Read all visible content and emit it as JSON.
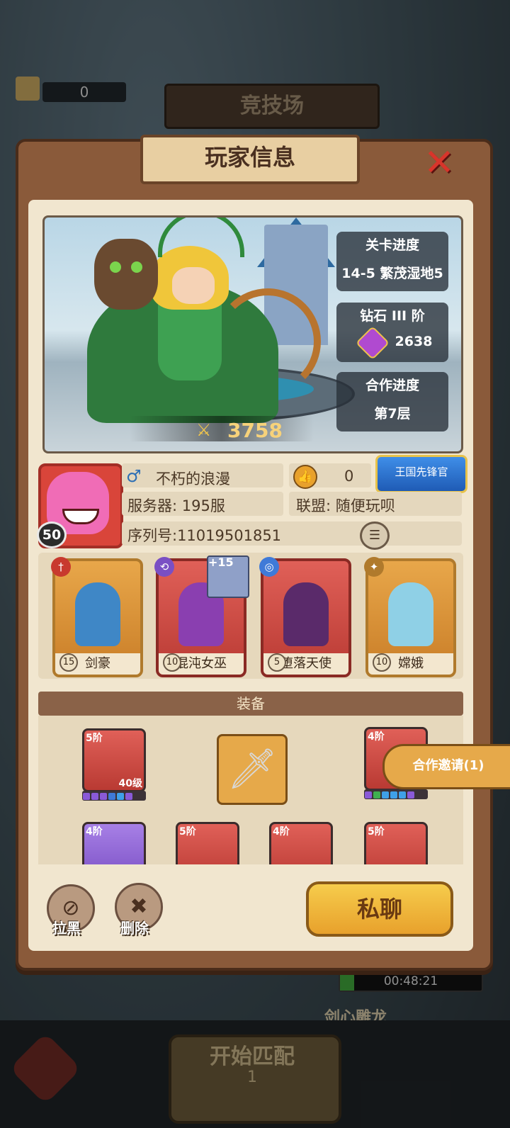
{
  "background": {
    "scroll_count": "0",
    "arena_title": "竞技场",
    "start_match_label": "开始匹配",
    "start_match_count": "1",
    "timer": "00:48:21",
    "bottom_text": "剑心雕龙"
  },
  "dialog": {
    "title": "玩家信息",
    "close_icon": "close-icon",
    "power": "3758",
    "stage_title": "关卡进度",
    "stage_value": "14-5 繁茂湿地5",
    "rank_title": "钻石 III 阶",
    "rank_value": "2638",
    "coop_title": "合作进度",
    "coop_value": "第7层",
    "player": {
      "level": "50",
      "gender_icon": "male-icon",
      "name": "不朽的浪漫",
      "likes": "0",
      "title_badge": "王国先锋官",
      "server": "服务器: 195服",
      "alliance": "联盟:  随便玩呗",
      "serial": "序列号:11019501851"
    },
    "heroes": [
      {
        "name": "剑豪",
        "level": "15",
        "plus": ""
      },
      {
        "name": "混沌女巫",
        "level": "10",
        "plus": "+15"
      },
      {
        "name": "堕落天使",
        "level": "5",
        "plus": ""
      },
      {
        "name": "嫦娥",
        "level": "10",
        "plus": ""
      }
    ],
    "equipment_header": "装备",
    "equipment": [
      {
        "tier": "5阶",
        "level": "40级"
      },
      {
        "tier": "4阶",
        "level": ""
      },
      {
        "tier": "4阶",
        "level": ""
      },
      {
        "tier": "5阶",
        "level": ""
      },
      {
        "tier": "4阶",
        "level": ""
      },
      {
        "tier": "5阶",
        "level": ""
      }
    ],
    "coop_invite": "合作邀请(1)",
    "block_label": "拉黑",
    "delete_label": "删除",
    "chat_label": "私聊"
  },
  "colors": {
    "frame": "#8a5a3a",
    "paper": "#f1e6cf",
    "accent": "#e8a12c",
    "close": "#d8352b"
  }
}
